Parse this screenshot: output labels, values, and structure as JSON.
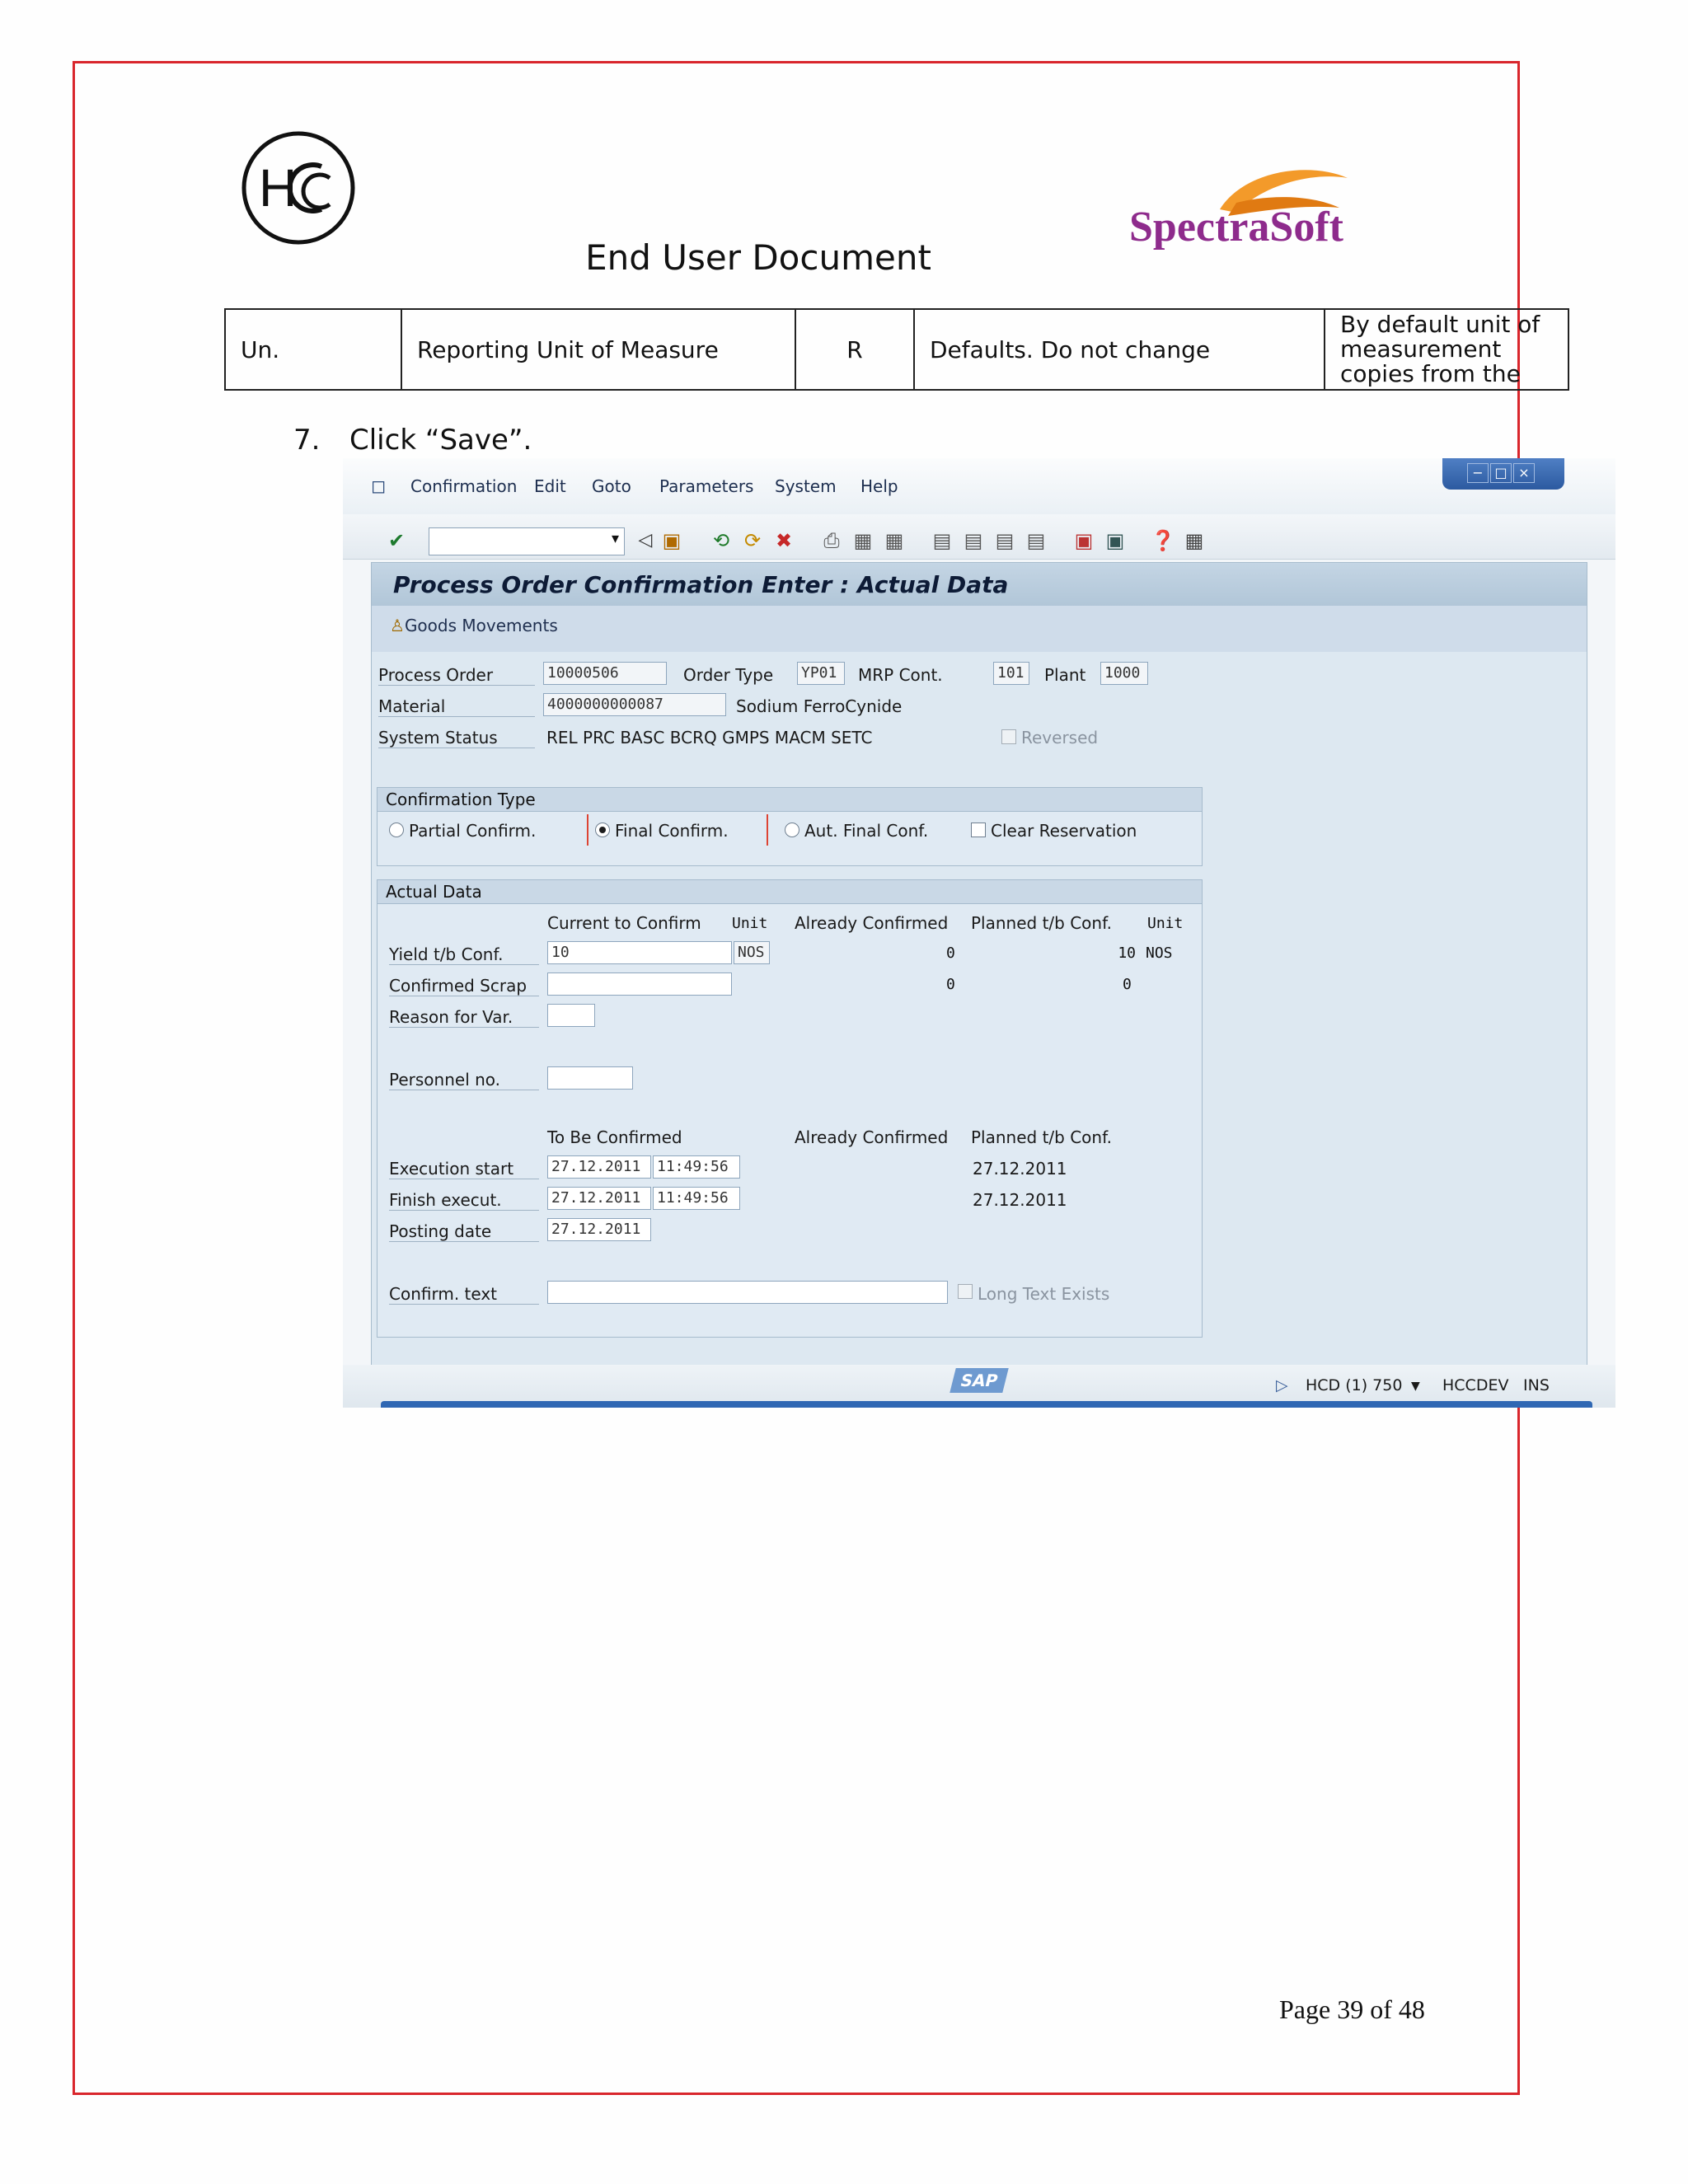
{
  "header": {
    "logo_left_text": "HCC",
    "doc_title": "End User Document",
    "logo_right_text": "SpectraSoft"
  },
  "table": {
    "row": [
      "Un.",
      "Reporting Unit of Measure",
      "R",
      "Defaults.  Do not change",
      "By default unit of measurement copies from the"
    ]
  },
  "step": {
    "number": "7.",
    "text": "Click “Save”."
  },
  "sap": {
    "menu": [
      "Confirmation",
      "Edit",
      "Goto",
      "Parameters",
      "System",
      "Help"
    ],
    "screen_title": "Process Order Confirmation Enter : Actual Data",
    "app_button": "Goods Movements",
    "header_fields": {
      "process_order_label": "Process Order",
      "process_order": "10000506",
      "order_type_label": "Order Type",
      "order_type": "YP01",
      "mrp_label": "MRP Cont.",
      "mrp": "101",
      "plant_label": "Plant",
      "plant": "1000",
      "material_label": "Material",
      "material": "4000000000087",
      "material_desc": "Sodium FerroCynide",
      "status_label": "System Status",
      "status": "REL  PRC  BASC BCRQ GMPS MACM SETC",
      "reversed": "Reversed"
    },
    "conf_type": {
      "title": "Confirmation Type",
      "partial": "Partial Confirm.",
      "final": "Final Confirm.",
      "aut_final": "Aut. Final Conf.",
      "clear": "Clear Reservation"
    },
    "actual": {
      "title": "Actual Data",
      "col_current": "Current to Confirm",
      "col_unit": "Unit",
      "col_already": "Already Confirmed",
      "col_planned": "Planned t/b Conf.",
      "col_unit2": "Unit",
      "yield_label": "Yield t/b Conf.",
      "yield_value": "10",
      "yield_unit": "NOS",
      "yield_already": "0",
      "yield_planned": "10",
      "yield_unit2": "NOS",
      "scrap_label": "Confirmed Scrap",
      "scrap_already": "0",
      "scrap_planned": "0",
      "reason_label": "Reason for Var.",
      "personnel_label": "Personnel no.",
      "col_tbc": "To Be Confirmed",
      "col_already2": "Already Confirmed",
      "col_planned2": "Planned t/b Conf.",
      "exec_label": "Execution start",
      "exec_date": "27.12.2011",
      "exec_time": "11:49:56",
      "exec_planned": "27.12.2011",
      "finish_label": "Finish execut.",
      "finish_date": "27.12.2011",
      "finish_time": "11:49:56",
      "finish_planned": "27.12.2011",
      "posting_label": "Posting date",
      "posting_date": "27.12.2011",
      "text_label": "Confirm. text",
      "long_text": "Long Text Exists"
    },
    "status": {
      "sap_logo": "SAP",
      "system": "HCD (1) 750",
      "server": "HCCDEV",
      "mode": "INS"
    }
  },
  "footer": {
    "page": "Page 39 of 48"
  }
}
